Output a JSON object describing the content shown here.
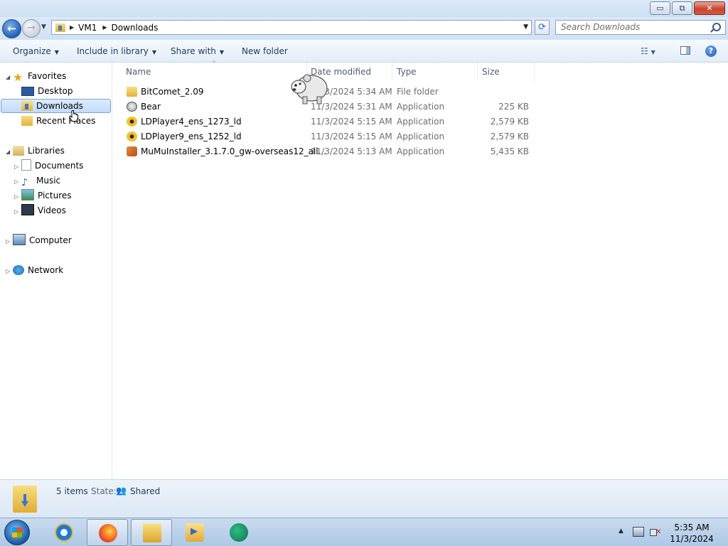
{
  "window": {
    "minimize": "▭",
    "maximize": "⧉",
    "close": "✕"
  },
  "address": {
    "crumbs": [
      "VM1",
      "Downloads"
    ],
    "search_placeholder": "Search Downloads"
  },
  "toolbar": {
    "organize": "Organize",
    "include_in_library": "Include in library",
    "share_with": "Share with",
    "new_folder": "New folder"
  },
  "nav": {
    "favorites": "Favorites",
    "desktop": "Desktop",
    "downloads": "Downloads",
    "recent_places": "Recent Places",
    "libraries": "Libraries",
    "documents": "Documents",
    "music": "Music",
    "pictures": "Pictures",
    "videos": "Videos",
    "computer": "Computer",
    "network": "Network"
  },
  "columns": {
    "name": "Name",
    "date_modified": "Date modified",
    "type": "Type",
    "size": "Size"
  },
  "files": [
    {
      "name": "BitComet_2.09",
      "date": "11/3/2024 5:34 AM",
      "type": "File folder",
      "size": "",
      "icon": "folder-icon"
    },
    {
      "name": "Bear",
      "date": "11/3/2024 5:31 AM",
      "type": "Application",
      "size": "225 KB",
      "icon": "bear-app-icon"
    },
    {
      "name": "LDPlayer4_ens_1273_ld",
      "date": "11/3/2024 5:15 AM",
      "type": "Application",
      "size": "2,579 KB",
      "icon": "ldplayer-icon"
    },
    {
      "name": "LDPlayer9_ens_1252_ld",
      "date": "11/3/2024 5:15 AM",
      "type": "Application",
      "size": "2,579 KB",
      "icon": "ldplayer-icon"
    },
    {
      "name": "MuMuInstaller_3.1.7.0_gw-overseas12_all...",
      "date": "11/3/2024 5:13 AM",
      "type": "Application",
      "size": "5,435 KB",
      "icon": "mumu-installer-icon"
    }
  ],
  "details": {
    "items_count": "5 items",
    "state_label": "State:",
    "state_value": "Shared"
  },
  "taskbar": {
    "time": "5:35 AM",
    "date": "11/3/2024"
  },
  "colors": {
    "selection": "#cde4fc",
    "chrome": "#d6e5f5",
    "text_muted": "#6d6d6d"
  }
}
